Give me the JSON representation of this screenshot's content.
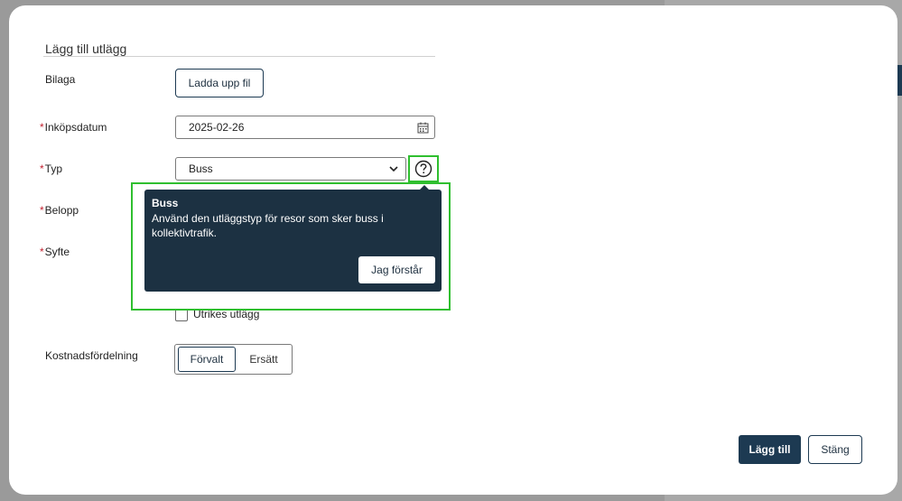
{
  "form": {
    "title": "Lägg till utlägg",
    "attachment": {
      "label": "Bilaga",
      "upload_button": "Ladda upp fil"
    },
    "purchase_date": {
      "required_mark": "*",
      "label": "Inköpsdatum",
      "value": "2025-02-26"
    },
    "type": {
      "required_mark": "*",
      "label": "Typ",
      "value": "Buss"
    },
    "amount": {
      "required_mark": "*",
      "label": "Belopp"
    },
    "purpose": {
      "required_mark": "*",
      "label": "Syfte"
    },
    "foreign": {
      "label": "Utrikes utlägg"
    },
    "cost_distribution": {
      "label": "Kostnadsfördelning",
      "options": [
        "Förvalt",
        "Ersätt"
      ]
    }
  },
  "tooltip": {
    "title": "Buss",
    "body": "Använd den utläggstyp för resor som sker buss i kollektivtrafik.",
    "button": "Jag förstår"
  },
  "footer": {
    "add_button": "Lägg till",
    "close_button": "Stäng"
  },
  "colors": {
    "primary": "#1d3a52",
    "tooltip_bg": "#1c3142",
    "required": "#c2202f",
    "highlight": "#2fbf2f"
  }
}
